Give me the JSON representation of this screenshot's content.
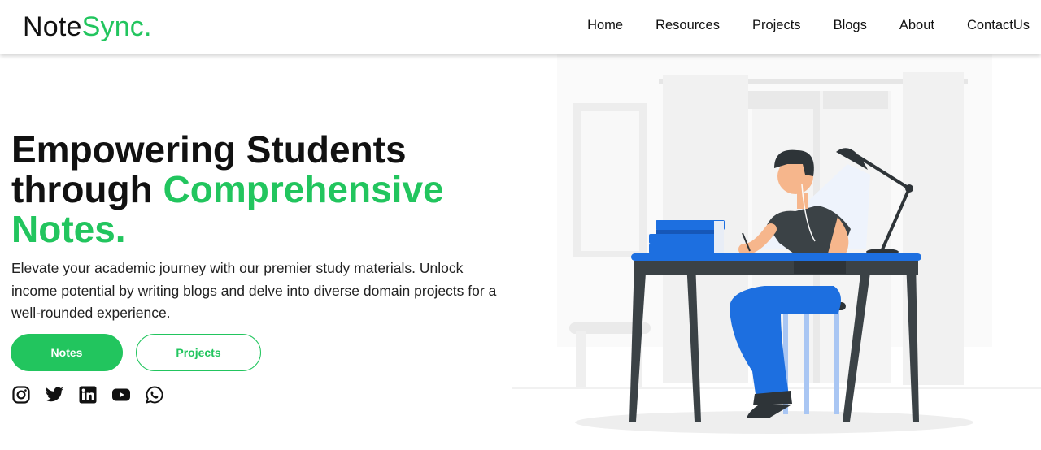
{
  "brand": {
    "name_main": "Note",
    "name_accent": "Sync."
  },
  "nav": {
    "items": [
      {
        "label": "Home"
      },
      {
        "label": "Resources"
      },
      {
        "label": "Projects"
      },
      {
        "label": "Blogs"
      },
      {
        "label": "About"
      },
      {
        "label": "ContactUs"
      }
    ]
  },
  "hero": {
    "title_line1": "Empowering Students",
    "title_line2": "through ",
    "title_highlight": "Comprehensive Notes.",
    "description": "Elevate your academic journey with our premier study materials. Unlock income potential by writing blogs and delve into diverse domain projects for a well-rounded experience."
  },
  "buttons": {
    "primary": "Notes",
    "secondary": "Projects"
  },
  "socials": [
    {
      "icon": "instagram-icon"
    },
    {
      "icon": "twitter-icon"
    },
    {
      "icon": "linkedin-icon"
    },
    {
      "icon": "youtube-icon"
    },
    {
      "icon": "whatsapp-icon"
    }
  ],
  "colors": {
    "accent": "#22c55e",
    "desk_top": "#1d6fe0",
    "pants": "#1d6fe0",
    "desk_legs": "#3b4246"
  }
}
